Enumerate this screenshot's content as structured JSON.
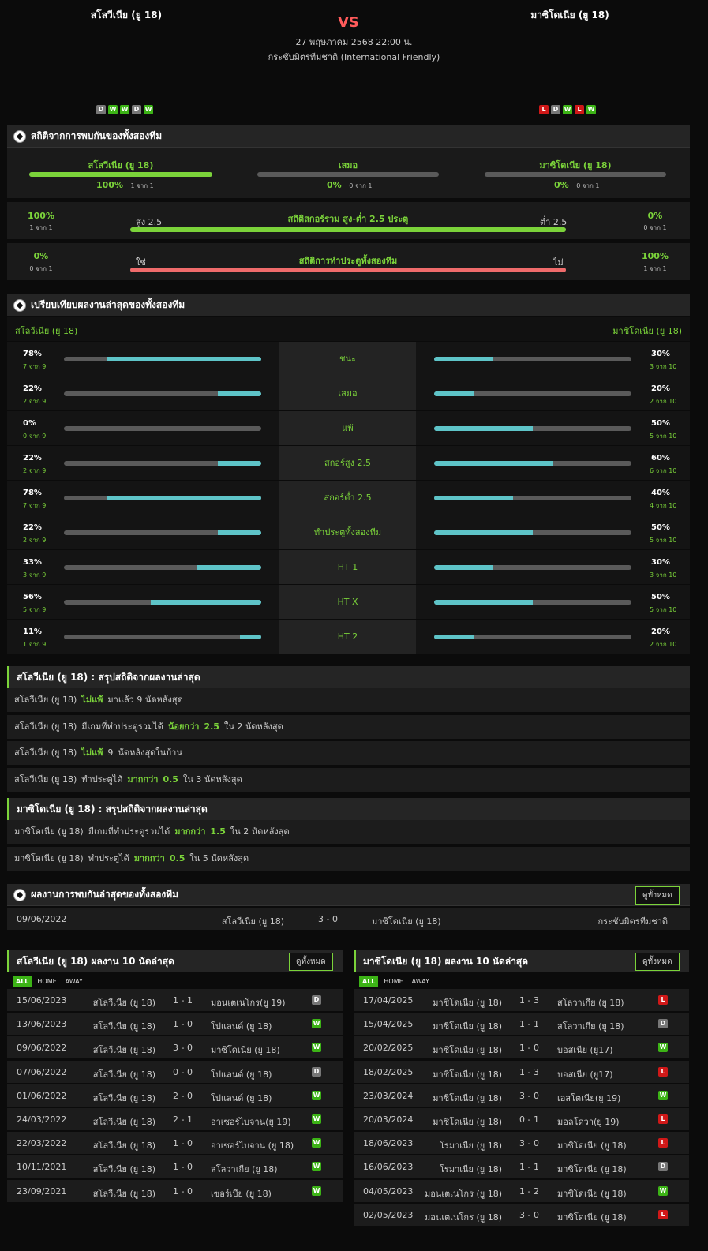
{
  "header": {
    "home_team": "สโลวีเนีย (ยู 18)",
    "away_team": "มาซิโดเนีย (ยู 18)",
    "vs": "VS",
    "datetime": "27 พฤษภาคม 2568 22:00 น.",
    "competition": "กระชับมิตรทีมชาติ (International Friendly)",
    "home_form": [
      "D",
      "W",
      "W",
      "D",
      "W"
    ],
    "away_form": [
      "L",
      "D",
      "W",
      "L",
      "W"
    ]
  },
  "h2h_stats": {
    "title": "สถิติจากการพบกันของทั้งสองทีม",
    "home": {
      "label": "สโลวีเนีย (ยู 18)",
      "pct": "100%",
      "sub": "1 จาก 1",
      "fill": 1.0
    },
    "draw": {
      "label": "เสมอ",
      "pct": "0%",
      "sub": "0 จาก 1",
      "fill": 0
    },
    "away": {
      "label": "มาซิโดเนีย (ยู 18)",
      "pct": "0%",
      "sub": "0 จาก 1",
      "fill": 0
    },
    "ou": {
      "title": "สถิติสกอร์รวม สูง-ต่ำ 2.5 ประตู",
      "left_pct": "100%",
      "left_sub": "1 จาก 1",
      "left_label": "สูง 2.5",
      "right_label": "ต่ำ 2.5",
      "right_pct": "0%",
      "right_sub": "0 จาก 1",
      "fill": 1.0
    },
    "btts": {
      "title": "สถิติการทำประตูทั้งสองทีม",
      "left_pct": "0%",
      "left_sub": "0 จาก 1",
      "left_label": "ใช่",
      "right_label": "ไม่",
      "right_pct": "100%",
      "right_sub": "1 จาก 1",
      "fill": 1.0
    }
  },
  "compare": {
    "title": "เปรียบเทียบผลงานล่าสุดของทั้งสองทีม",
    "home_label": "สโลวีเนีย (ยู 18)",
    "away_label": "มาซิโดเนีย (ยู 18)",
    "rows": [
      {
        "label": "ชนะ",
        "hp": "78%",
        "hs": "7 จาก 9",
        "hf": 0.78,
        "ap": "30%",
        "as": "3 จาก 10",
        "af": 0.3
      },
      {
        "label": "เสมอ",
        "hp": "22%",
        "hs": "2 จาก 9",
        "hf": 0.22,
        "ap": "20%",
        "as": "2 จาก 10",
        "af": 0.2
      },
      {
        "label": "แพ้",
        "hp": "0%",
        "hs": "0 จาก 9",
        "hf": 0,
        "ap": "50%",
        "as": "5 จาก 10",
        "af": 0.5
      },
      {
        "label": "สกอร์สูง 2.5",
        "hp": "22%",
        "hs": "2 จาก 9",
        "hf": 0.22,
        "ap": "60%",
        "as": "6 จาก 10",
        "af": 0.6
      },
      {
        "label": "สกอร์ต่ำ 2.5",
        "hp": "78%",
        "hs": "7 จาก 9",
        "hf": 0.78,
        "ap": "40%",
        "as": "4 จาก 10",
        "af": 0.4
      },
      {
        "label": "ทำประตูทั้งสองทีม",
        "hp": "22%",
        "hs": "2 จาก 9",
        "hf": 0.22,
        "ap": "50%",
        "as": "5 จาก 10",
        "af": 0.5
      },
      {
        "label": "HT 1",
        "hp": "33%",
        "hs": "3 จาก 9",
        "hf": 0.33,
        "ap": "30%",
        "as": "3 จาก 10",
        "af": 0.3
      },
      {
        "label": "HT X",
        "hp": "56%",
        "hs": "5 จาก 9",
        "hf": 0.56,
        "ap": "50%",
        "as": "5 จาก 10",
        "af": 0.5
      },
      {
        "label": "HT 2",
        "hp": "11%",
        "hs": "1 จาก 9",
        "hf": 0.11,
        "ap": "20%",
        "as": "2 จาก 10",
        "af": 0.2
      }
    ]
  },
  "home_summary": {
    "title": "สโลวีเนีย (ยู 18) : สรุปสถิติจากผลงานล่าสุด",
    "rows": [
      [
        {
          "t": "สโลวีเนีย (ยู 18)"
        },
        {
          "t": "ไม่แพ้",
          "g": true
        },
        {
          "t": "มาแล้ว 9 นัดหลังสุด"
        }
      ],
      [
        {
          "t": "สโลวีเนีย (ยู 18)"
        },
        {
          "t": "มีเกมที่ทำประตูรวมได้"
        },
        {
          "t": "น้อยกว่า",
          "g": true
        },
        {
          "t": "2.5",
          "g": true
        },
        {
          "t": "ใน 2 นัดหลังสุด"
        }
      ],
      [
        {
          "t": "สโลวีเนีย (ยู 18)"
        },
        {
          "t": "ไม่แพ้",
          "g": true
        },
        {
          "t": "9"
        },
        {
          "t": "นัดหลังสุดในบ้าน"
        }
      ],
      [
        {
          "t": "สโลวีเนีย (ยู 18)"
        },
        {
          "t": "ทำประตูได้"
        },
        {
          "t": "มากกว่า",
          "g": true
        },
        {
          "t": "0.5",
          "g": true
        },
        {
          "t": "ใน 3 นัดหลังสุด"
        }
      ]
    ]
  },
  "away_summary": {
    "title": "มาซิโดเนีย (ยู 18) : สรุปสถิติจากผลงานล่าสุด",
    "rows": [
      [
        {
          "t": "มาซิโดเนีย (ยู 18)"
        },
        {
          "t": "มีเกมที่ทำประตูรวมได้"
        },
        {
          "t": "มากกว่า",
          "g": true
        },
        {
          "t": "1.5",
          "g": true
        },
        {
          "t": "ใน 2 นัดหลังสุด"
        }
      ],
      [
        {
          "t": "มาซิโดเนีย (ยู 18)"
        },
        {
          "t": "ทำประตูได้"
        },
        {
          "t": "มากกว่า",
          "g": true
        },
        {
          "t": "0.5",
          "g": true
        },
        {
          "t": "ใน 5 นัดหลังสุด"
        }
      ]
    ]
  },
  "h2h_results": {
    "title": "ผลงานการพบกันล่าสุดของทั้งสองทีม",
    "view_all": "ดูทั้งหมด",
    "rows": [
      {
        "date": "09/06/2022",
        "home": "สโลวีเนีย (ยู 18)",
        "score": "3 - 0",
        "away": "มาซิโดเนีย (ยู 18)",
        "comp": "กระชับมิตรทีมชาติ"
      }
    ]
  },
  "home_last10": {
    "title": "สโลวีเนีย (ยู 18) ผลงาน 10 นัดล่าสุด",
    "view_all": "ดูทั้งหมด",
    "tabs": [
      "ALL",
      "HOME",
      "AWAY"
    ],
    "rows": [
      {
        "date": "15/06/2023",
        "home": "สโลวีเนีย (ยู 18)",
        "score": "1 - 1",
        "away": "มอนเตเนโกร(ยู 19)",
        "res": "D"
      },
      {
        "date": "13/06/2023",
        "home": "สโลวีเนีย (ยู 18)",
        "score": "1 - 0",
        "away": "โปแลนด์ (ยู 18)",
        "res": "W"
      },
      {
        "date": "09/06/2022",
        "home": "สโลวีเนีย (ยู 18)",
        "score": "3 - 0",
        "away": "มาซิโดเนีย (ยู 18)",
        "res": "W"
      },
      {
        "date": "07/06/2022",
        "home": "สโลวีเนีย (ยู 18)",
        "score": "0 - 0",
        "away": "โปแลนด์ (ยู 18)",
        "res": "D"
      },
      {
        "date": "01/06/2022",
        "home": "สโลวีเนีย (ยู 18)",
        "score": "2 - 0",
        "away": "โปแลนด์ (ยู 18)",
        "res": "W"
      },
      {
        "date": "24/03/2022",
        "home": "สโลวีเนีย (ยู 18)",
        "score": "2 - 1",
        "away": "อาเซอร์ไบจาน(ยู 19)",
        "res": "W"
      },
      {
        "date": "22/03/2022",
        "home": "สโลวีเนีย (ยู 18)",
        "score": "1 - 0",
        "away": "อาเซอร์ไบจาน (ยู 18)",
        "res": "W"
      },
      {
        "date": "10/11/2021",
        "home": "สโลวีเนีย (ยู 18)",
        "score": "1 - 0",
        "away": "สโลวาเกีย (ยู 18)",
        "res": "W"
      },
      {
        "date": "23/09/2021",
        "home": "สโลวีเนีย (ยู 18)",
        "score": "1 - 0",
        "away": "เซอร์เบีย (ยู 18)",
        "res": "W"
      }
    ]
  },
  "away_last10": {
    "title": "มาซิโดเนีย (ยู 18) ผลงาน 10 นัดล่าสุด",
    "view_all": "ดูทั้งหมด",
    "tabs": [
      "ALL",
      "HOME",
      "AWAY"
    ],
    "rows": [
      {
        "date": "17/04/2025",
        "home": "มาซิโดเนีย (ยู 18)",
        "score": "1 - 3",
        "away": "สโลวาเกีย (ยู 18)",
        "res": "L"
      },
      {
        "date": "15/04/2025",
        "home": "มาซิโดเนีย (ยู 18)",
        "score": "1 - 1",
        "away": "สโลวาเกีย (ยู 18)",
        "res": "D"
      },
      {
        "date": "20/02/2025",
        "home": "มาซิโดเนีย (ยู 18)",
        "score": "1 - 0",
        "away": "บอสเนีย (ยู17)",
        "res": "W"
      },
      {
        "date": "18/02/2025",
        "home": "มาซิโดเนีย (ยู 18)",
        "score": "1 - 3",
        "away": "บอสเนีย (ยู17)",
        "res": "L"
      },
      {
        "date": "23/03/2024",
        "home": "มาซิโดเนีย (ยู 18)",
        "score": "3 - 0",
        "away": "เอสโตเนีย(ยู 19)",
        "res": "W"
      },
      {
        "date": "20/03/2024",
        "home": "มาซิโดเนีย (ยู 18)",
        "score": "0 - 1",
        "away": "มอลโดวา(ยู 19)",
        "res": "L"
      },
      {
        "date": "18/06/2023",
        "home": "โรมาเนีย (ยู 18)",
        "score": "3 - 0",
        "away": "มาซิโดเนีย (ยู 18)",
        "res": "L"
      },
      {
        "date": "16/06/2023",
        "home": "โรมาเนีย (ยู 18)",
        "score": "1 - 1",
        "away": "มาซิโดเนีย (ยู 18)",
        "res": "D"
      },
      {
        "date": "04/05/2023",
        "home": "มอนเตเนโกร (ยู 18)",
        "score": "1 - 2",
        "away": "มาซิโดเนีย (ยู 18)",
        "res": "W"
      },
      {
        "date": "02/05/2023",
        "home": "มอนเตเนโกร (ยู 18)",
        "score": "3 - 0",
        "away": "มาซิโดเนีย (ยู 18)",
        "res": "L"
      }
    ]
  },
  "colors": {
    "accent_green": "#7bd33a",
    "bar_teal": "#5ec4c8",
    "bar_red": "#ef6b6b",
    "win": "#3cb316",
    "draw": "#777777",
    "loss": "#d01818"
  }
}
